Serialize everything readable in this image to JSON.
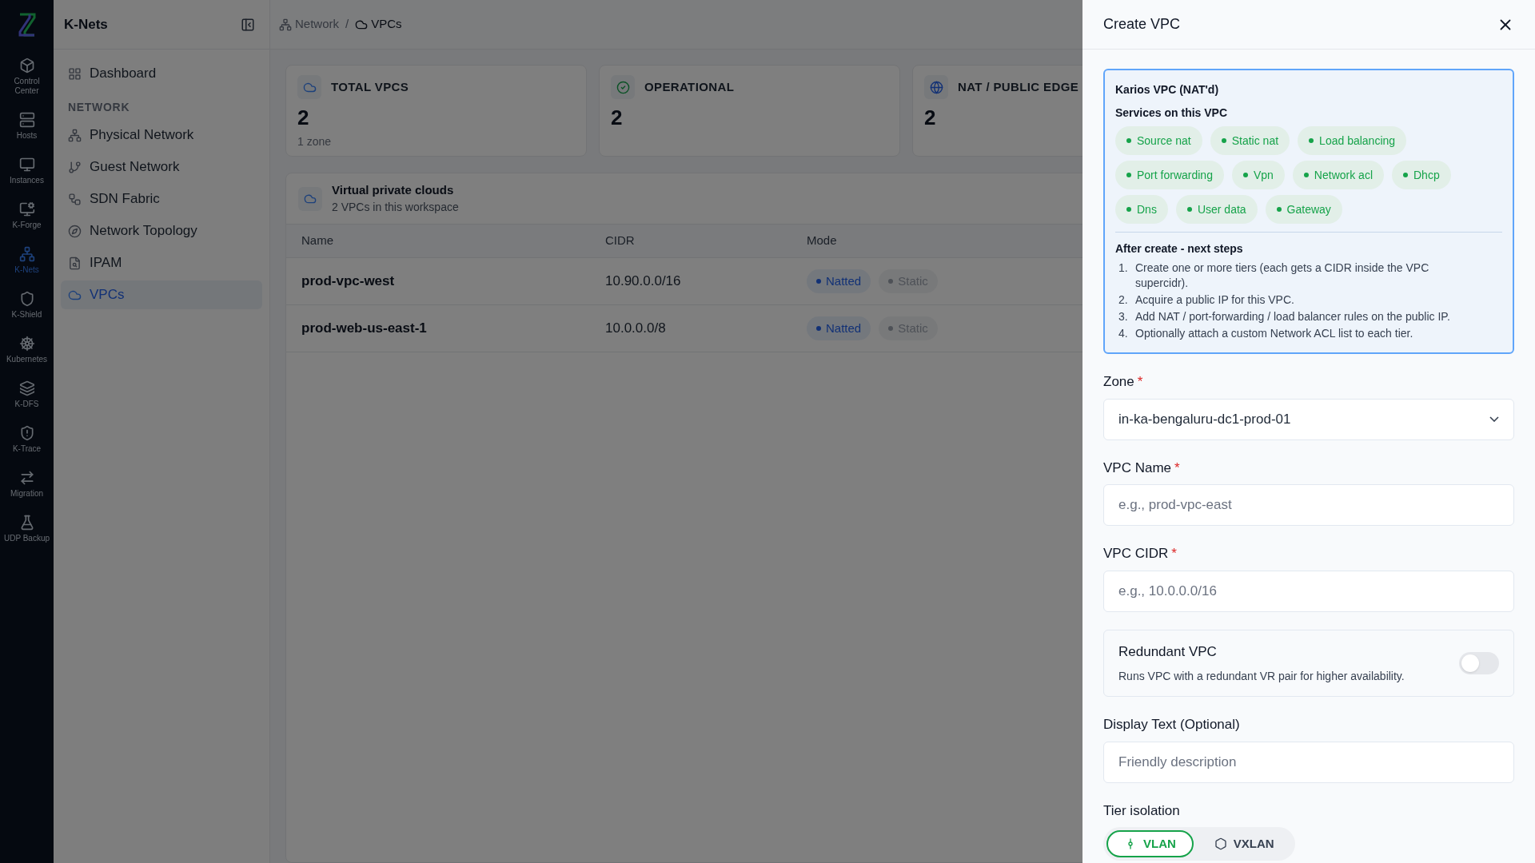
{
  "rail": {
    "items": [
      {
        "label": "Control Center",
        "selected": false
      },
      {
        "label": "Hosts",
        "selected": false
      },
      {
        "label": "Instances",
        "selected": false
      },
      {
        "label": "K-Forge",
        "selected": false
      },
      {
        "label": "K-Nets",
        "selected": true
      },
      {
        "label": "K-Shield",
        "selected": false
      },
      {
        "label": "Kubernetes",
        "selected": false
      },
      {
        "label": "K-DFS",
        "selected": false
      },
      {
        "label": "K-Trace",
        "selected": false
      },
      {
        "label": "Migration",
        "selected": false
      },
      {
        "label": "UDP Backup",
        "selected": false
      }
    ]
  },
  "sidebar": {
    "title": "K-Nets",
    "items": [
      {
        "kind": "link",
        "label": "Dashboard",
        "selected": false
      },
      {
        "kind": "section",
        "label": "NETWORK"
      },
      {
        "kind": "link",
        "label": "Physical Network",
        "selected": false
      },
      {
        "kind": "link",
        "label": "Guest Network",
        "selected": false
      },
      {
        "kind": "link",
        "label": "SDN Fabric",
        "selected": false
      },
      {
        "kind": "link",
        "label": "Network Topology",
        "selected": false
      },
      {
        "kind": "link",
        "label": "IPAM",
        "selected": false
      },
      {
        "kind": "link",
        "label": "VPCs",
        "selected": true
      }
    ]
  },
  "breadcrumb": {
    "separator": "/",
    "items": [
      "Network",
      "VPCs"
    ]
  },
  "stats": [
    {
      "kind": "cloud",
      "title": "TOTAL VPCS",
      "value": "2",
      "sub": "1 zone"
    },
    {
      "kind": "check",
      "title": "OPERATIONAL",
      "value": "2"
    },
    {
      "kind": "globe",
      "title": "NAT / PUBLIC EDGE",
      "value": "2"
    }
  ],
  "vpcs": {
    "title": "Virtual private clouds",
    "subtitle": "2 VPCs in this workspace",
    "columns": [
      "Name",
      "CIDR",
      "Mode"
    ],
    "rows": [
      {
        "name": "prod-vpc-west",
        "cidr": "10.90.0.0/16",
        "modes": [
          {
            "label": "Natted",
            "selected": true
          },
          {
            "label": "Static",
            "selected": false
          }
        ]
      },
      {
        "name": "prod-web-us-east-1",
        "cidr": "10.0.0.0/8",
        "modes": [
          {
            "label": "Natted",
            "selected": true
          },
          {
            "label": "Static",
            "selected": false
          }
        ]
      }
    ]
  },
  "drawer": {
    "title": "Create VPC",
    "info": {
      "title": "Karios VPC (NAT'd)",
      "services_heading": "Services on this VPC",
      "services": [
        "Source nat",
        "Static nat",
        "Load balancing",
        "Port forwarding",
        "Vpn",
        "Network acl",
        "Dhcp",
        "Dns",
        "User data",
        "Gateway"
      ],
      "steps_heading": "After create - next steps",
      "steps": [
        {
          "number": "1.",
          "text": "Create one or more tiers (each gets a CIDR inside the VPC supercidr)."
        },
        {
          "number": "2.",
          "text": "Acquire a public IP for this VPC."
        },
        {
          "number": "3.",
          "text": "Add NAT / port-forwarding / load balancer rules on the public IP."
        },
        {
          "number": "4.",
          "text": "Optionally attach a custom Network ACL list to each tier."
        }
      ]
    },
    "fields": [
      {
        "kind": "select",
        "label": "Zone",
        "required_mark": "*",
        "value": "in-ka-bengaluru-dc1-prod-01"
      },
      {
        "kind": "text",
        "label": "VPC Name",
        "required_mark": "*",
        "placeholder": "e.g., prod-vpc-east"
      },
      {
        "kind": "text",
        "label": "VPC CIDR",
        "required_mark": "*",
        "placeholder": "e.g., 10.0.0.0/16"
      },
      {
        "kind": "toggle",
        "label": "Redundant VPC",
        "description": "Runs VPC with a redundant VR pair for higher availability.",
        "on": false
      },
      {
        "kind": "text",
        "label": "Display Text (Optional)",
        "placeholder": "Friendly description"
      },
      {
        "kind": "segmented",
        "label": "Tier isolation",
        "options": [
          {
            "label": "VLAN",
            "selected": true
          },
          {
            "label": "VXLAN",
            "selected": false
          }
        ]
      }
    ]
  }
}
